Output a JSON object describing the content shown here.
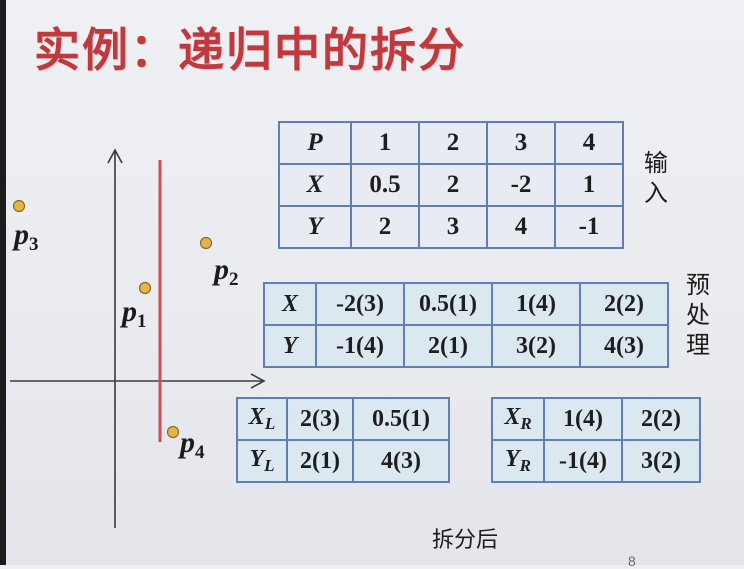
{
  "title": "实例：递归中的拆分",
  "plot": {
    "points": [
      {
        "name": "p",
        "sub": "1",
        "dot_id": "p1"
      },
      {
        "name": "p",
        "sub": "2",
        "dot_id": "p2"
      },
      {
        "name": "p",
        "sub": "3",
        "dot_id": "p3"
      },
      {
        "name": "p",
        "sub": "4",
        "dot_id": "p4"
      }
    ],
    "colors": {
      "dot": "#e3b547",
      "dot_stroke": "#8a6b2a",
      "divider": "#d44a52",
      "axis": "#3a3a3a"
    }
  },
  "input_table": {
    "rows": [
      {
        "head": "P",
        "cells": [
          "1",
          "2",
          "3",
          "4"
        ]
      },
      {
        "head": "X",
        "cells": [
          "0.5",
          "2",
          "-2",
          "1"
        ]
      },
      {
        "head": "Y",
        "cells": [
          "2",
          "3",
          "4",
          "-1"
        ]
      }
    ],
    "side_label": [
      "输",
      "入"
    ]
  },
  "preprocess_table": {
    "rows": [
      {
        "head": "X",
        "cells": [
          "-2(3)",
          "0.5(1)",
          "1(4)",
          "2(2)"
        ]
      },
      {
        "head": "Y",
        "cells": [
          "-1(4)",
          "2(1)",
          "3(2)",
          "4(3)"
        ]
      }
    ],
    "side_label": [
      "预",
      "处",
      "理"
    ]
  },
  "left_table": {
    "rows": [
      {
        "head": "X",
        "sub": "L",
        "cells": [
          "2(3)",
          "0.5(1)"
        ]
      },
      {
        "head": "Y",
        "sub": "L",
        "cells": [
          "2(1)",
          "4(3)"
        ]
      }
    ]
  },
  "right_table": {
    "rows": [
      {
        "head": "X",
        "sub": "R",
        "cells": [
          "1(4)",
          "2(2)"
        ]
      },
      {
        "head": "Y",
        "sub": "R",
        "cells": [
          "-1(4)",
          "3(2)"
        ]
      }
    ]
  },
  "caption": "拆分后",
  "page_number": "8"
}
